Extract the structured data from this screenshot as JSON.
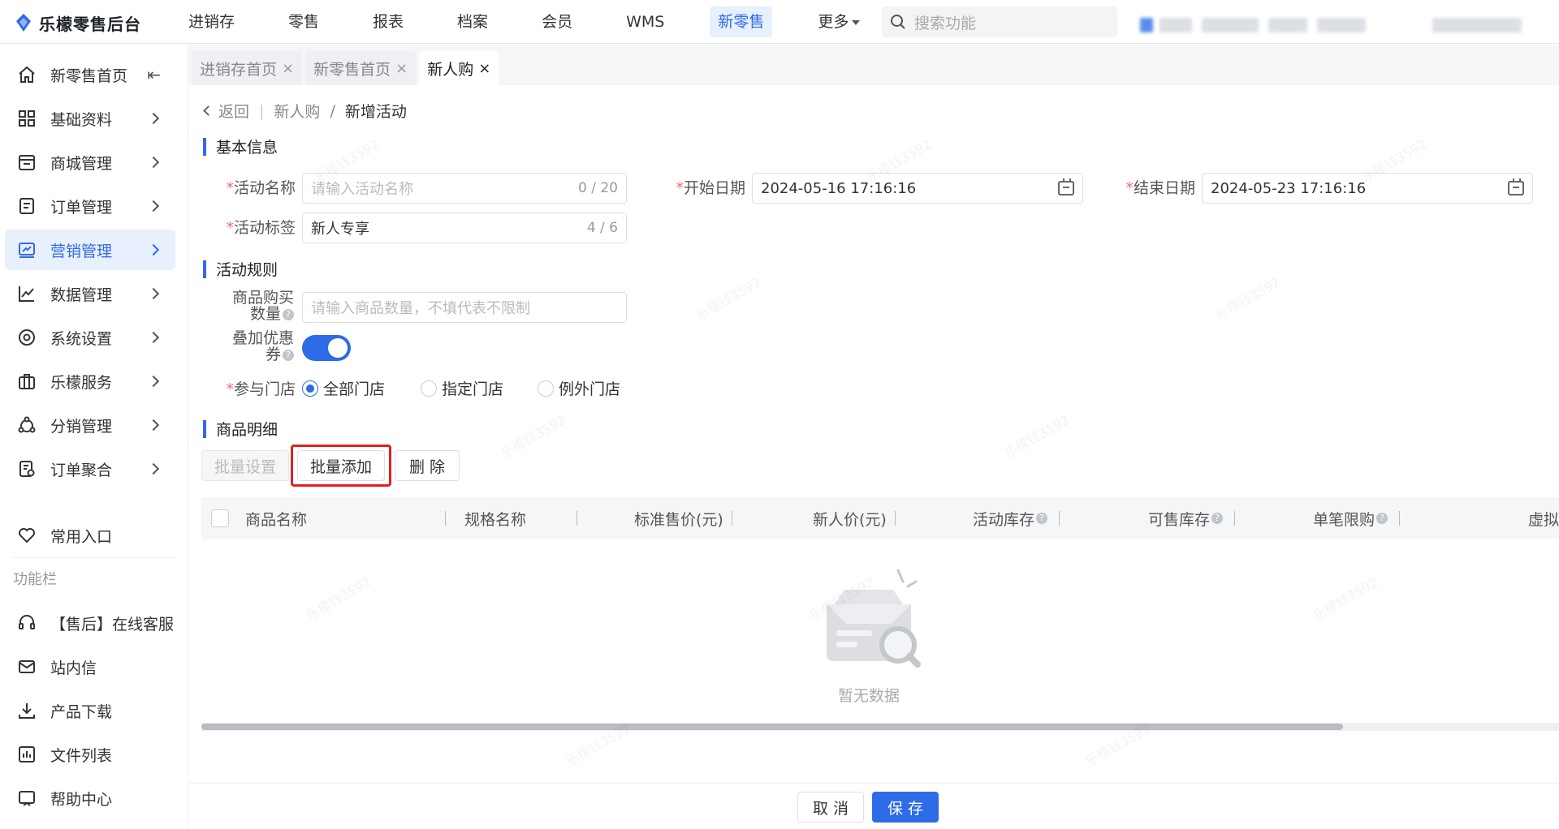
{
  "app": {
    "title": "乐檬零售后台"
  },
  "topnav": {
    "items": [
      "进销存",
      "零售",
      "报表",
      "档案",
      "会员",
      "WMS",
      "新零售",
      "更多"
    ],
    "active": "新零售",
    "search_placeholder": "搜索功能"
  },
  "sidebar": {
    "items": [
      {
        "label": "新零售首页",
        "icon": "home-icon"
      },
      {
        "label": "基础资料",
        "icon": "grid-icon"
      },
      {
        "label": "商城管理",
        "icon": "store-icon"
      },
      {
        "label": "订单管理",
        "icon": "order-icon"
      },
      {
        "label": "营销管理",
        "icon": "marketing-icon",
        "active": true
      },
      {
        "label": "数据管理",
        "icon": "chart-icon"
      },
      {
        "label": "系统设置",
        "icon": "settings-icon"
      },
      {
        "label": "乐檬服务",
        "icon": "service-icon"
      },
      {
        "label": "分销管理",
        "icon": "distribution-icon"
      },
      {
        "label": "订单聚合",
        "icon": "aggregate-icon"
      }
    ],
    "common_entry": "常用入口",
    "section_label": "功能栏",
    "tools": [
      {
        "label": "【售后】在线客服",
        "icon": "headset-icon"
      },
      {
        "label": "站内信",
        "icon": "mail-icon"
      },
      {
        "label": "产品下载",
        "icon": "download-icon"
      },
      {
        "label": "文件列表",
        "icon": "file-list-icon"
      },
      {
        "label": "帮助中心",
        "icon": "help-icon"
      }
    ]
  },
  "tabs": [
    {
      "label": "进销存首页",
      "active": false
    },
    {
      "label": "新零售首页",
      "active": false
    },
    {
      "label": "新人购",
      "active": true
    }
  ],
  "breadcrumb": {
    "back": "返回",
    "parent": "新人购",
    "separator": "/",
    "current": "新增活动"
  },
  "basic_info": {
    "title": "基本信息",
    "name_label": "活动名称",
    "name_placeholder": "请输入活动名称",
    "name_count": "0 / 20",
    "start_label": "开始日期",
    "start_value": "2024-05-16 17:16:16",
    "end_label": "结束日期",
    "end_value": "2024-05-23 17:16:16",
    "tag_label": "活动标签",
    "tag_value": "新人专享",
    "tag_count": "4 / 6"
  },
  "rules": {
    "title": "活动规则",
    "qty_label_1": "商品购买",
    "qty_label_2": "数量",
    "qty_placeholder": "请输入商品数量，不填代表不限制",
    "coupon_label_1": "叠加优惠",
    "coupon_label_2": "券",
    "coupon_enabled": true,
    "stores_label": "参与门店",
    "store_options": [
      "全部门店",
      "指定门店",
      "例外门店"
    ],
    "store_selected": "全部门店"
  },
  "detail": {
    "title": "商品明细",
    "btn_batch_set": "批量设置",
    "btn_batch_add": "批量添加",
    "btn_delete": "删 除",
    "columns": [
      "商品名称",
      "规格名称",
      "标准售价(元)",
      "新人价(元)",
      "活动库存",
      "可售库存",
      "单笔限购",
      "虚拟"
    ],
    "empty_text": "暂无数据"
  },
  "footer": {
    "cancel": "取 消",
    "save": "保 存"
  },
  "colors": {
    "primary": "#2e6be6",
    "required": "#f56c6c",
    "highlight": "#e02020"
  },
  "watermark": "乐檬钱3592"
}
